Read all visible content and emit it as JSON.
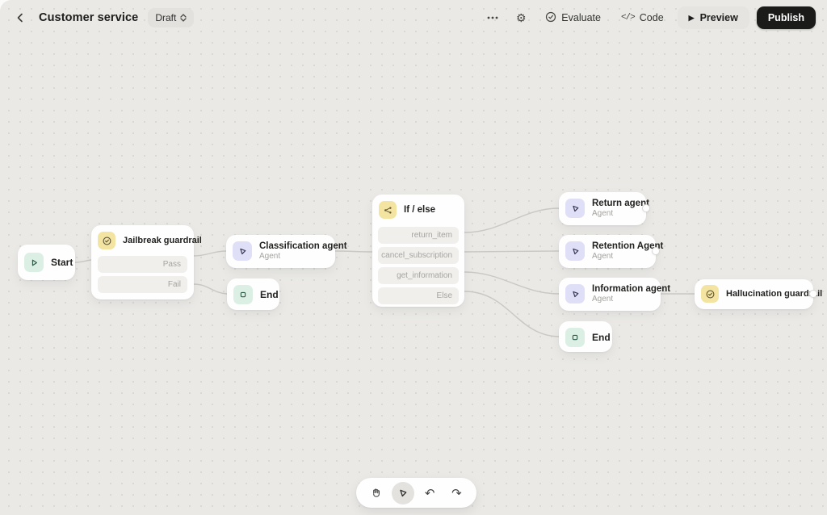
{
  "header": {
    "title": "Customer service",
    "draft_label": "Draft",
    "evaluate_label": "Evaluate",
    "code_label": "Code",
    "code_glyph": "</>",
    "preview_label": "Preview",
    "preview_play": "▶",
    "publish_label": "Publish",
    "gear_glyph": "⚙"
  },
  "nodes": {
    "start": {
      "label": "Start"
    },
    "jailbreak": {
      "title": "Jailbreak guardrail",
      "rows": [
        "Pass",
        "Fail"
      ]
    },
    "classification": {
      "title": "Classification agent",
      "subtitle": "Agent"
    },
    "end_left": {
      "label": "End"
    },
    "ifelse": {
      "title": "If / else",
      "rows": [
        "return_item",
        "cancel_subscription",
        "get_information",
        "Else"
      ]
    },
    "return_agent": {
      "title": "Return agent",
      "subtitle": "Agent"
    },
    "retention_agent": {
      "title": "Retention Agent",
      "subtitle": "Agent"
    },
    "information_agent": {
      "title": "Information agent",
      "subtitle": "Agent"
    },
    "end_right": {
      "label": "End"
    },
    "hallucination": {
      "title": "Hallucination guardrail"
    }
  },
  "toolbar": {
    "undo_glyph": "↶",
    "redo_glyph": "↷"
  },
  "colors": {
    "canvas_bg": "#eae9e6",
    "node_bg": "#fefefe",
    "guardrail_icon_bg": "#f4e4a1",
    "agent_icon_bg": "#e0dff8",
    "start_end_icon_bg": "#dcefe4",
    "edge": "#c9c8c4",
    "publish_bg": "#1b1b1a",
    "row_pill_bg": "#f0efec"
  }
}
